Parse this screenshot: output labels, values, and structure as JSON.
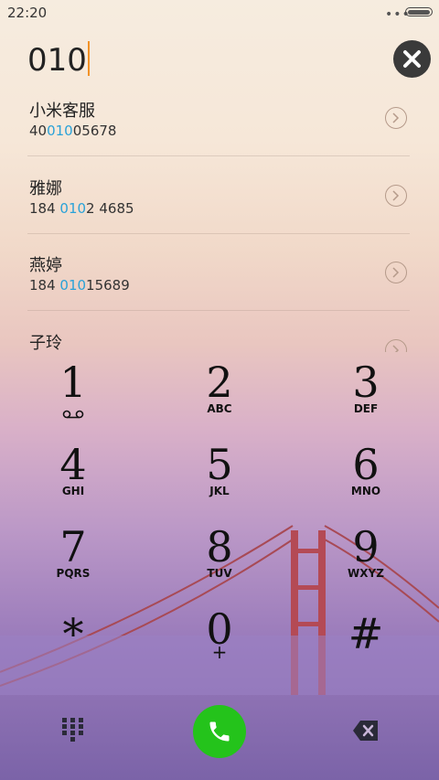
{
  "status_bar": {
    "time": "22:20"
  },
  "dialer": {
    "input_value": "010"
  },
  "results": [
    {
      "name": "小米客服",
      "number_pre": "40",
      "number_match": "010",
      "number_post": "05678"
    },
    {
      "name": "雅娜",
      "number_pre": "184 ",
      "number_match": "010",
      "number_post": "2 4685"
    },
    {
      "name": "燕婷",
      "number_pre": "184 ",
      "number_match": "010",
      "number_post": "15689"
    },
    {
      "name": "子玲",
      "number_pre": "",
      "number_match": "",
      "number_post": ""
    }
  ],
  "keypad": [
    {
      "digit": "1",
      "letters": ""
    },
    {
      "digit": "2",
      "letters": "ABC"
    },
    {
      "digit": "3",
      "letters": "DEF"
    },
    {
      "digit": "4",
      "letters": "GHI"
    },
    {
      "digit": "5",
      "letters": "JKL"
    },
    {
      "digit": "6",
      "letters": "MNO"
    },
    {
      "digit": "7",
      "letters": "PQRS"
    },
    {
      "digit": "8",
      "letters": "TUV"
    },
    {
      "digit": "9",
      "letters": "WXYZ"
    },
    {
      "digit": "*",
      "letters": ""
    },
    {
      "digit": "0",
      "letters": "+"
    },
    {
      "digit": "#",
      "letters": ""
    }
  ],
  "icons": {
    "clear": "close-icon",
    "voicemail": "voicemail-icon",
    "keypad_toggle": "keypad-grid-icon",
    "call": "phone-icon",
    "backspace": "backspace-icon",
    "details": "chevron-right-icon"
  },
  "colors": {
    "match_highlight": "#2aa2d8",
    "call_button": "#24c31b",
    "cursor": "#f29227"
  }
}
